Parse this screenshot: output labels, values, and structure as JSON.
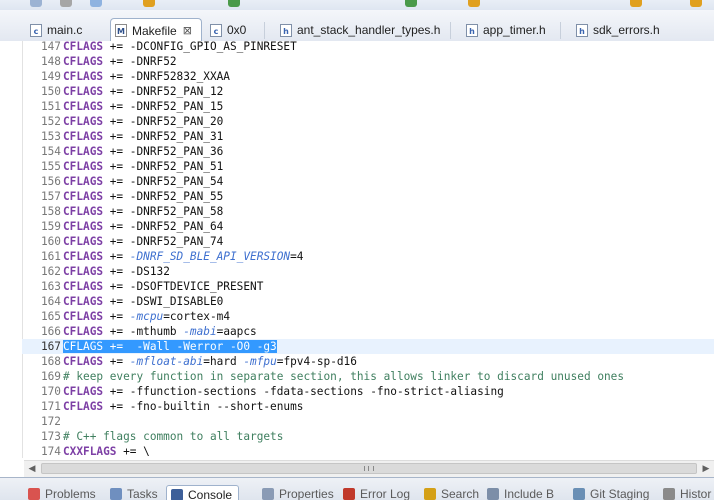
{
  "editor_tabs": [
    {
      "label": "main.c",
      "icon": "c-source-file-icon",
      "active": false
    },
    {
      "label": "Makefile",
      "icon": "makefile-icon",
      "active": true
    },
    {
      "label": "0x0",
      "icon": "c-source-file-icon",
      "active": false
    },
    {
      "label": "ant_stack_handler_types.h",
      "icon": "header-file-icon",
      "active": false
    },
    {
      "label": "app_timer.h",
      "icon": "header-file-icon",
      "active": false
    },
    {
      "label": "sdk_errors.h",
      "icon": "header-file-icon",
      "active": false
    }
  ],
  "close_glyph": "⊠",
  "code_lines": [
    {
      "num": "147",
      "segments": [
        [
          "var",
          "CFLAGS"
        ],
        [
          "code",
          " += -DCONFIG_GPIO_AS_PINRESET"
        ]
      ]
    },
    {
      "num": "148",
      "segments": [
        [
          "var",
          "CFLAGS"
        ],
        [
          "code",
          " += -DNRF52"
        ]
      ]
    },
    {
      "num": "149",
      "segments": [
        [
          "var",
          "CFLAGS"
        ],
        [
          "code",
          " += -DNRF52832_XXAA"
        ]
      ]
    },
    {
      "num": "150",
      "segments": [
        [
          "var",
          "CFLAGS"
        ],
        [
          "code",
          " += -DNRF52_PAN_12"
        ]
      ]
    },
    {
      "num": "151",
      "segments": [
        [
          "var",
          "CFLAGS"
        ],
        [
          "code",
          " += -DNRF52_PAN_15"
        ]
      ]
    },
    {
      "num": "152",
      "segments": [
        [
          "var",
          "CFLAGS"
        ],
        [
          "code",
          " += -DNRF52_PAN_20"
        ]
      ]
    },
    {
      "num": "153",
      "segments": [
        [
          "var",
          "CFLAGS"
        ],
        [
          "code",
          " += -DNRF52_PAN_31"
        ]
      ]
    },
    {
      "num": "154",
      "segments": [
        [
          "var",
          "CFLAGS"
        ],
        [
          "code",
          " += -DNRF52_PAN_36"
        ]
      ]
    },
    {
      "num": "155",
      "segments": [
        [
          "var",
          "CFLAGS"
        ],
        [
          "code",
          " += -DNRF52_PAN_51"
        ]
      ]
    },
    {
      "num": "156",
      "segments": [
        [
          "var",
          "CFLAGS"
        ],
        [
          "code",
          " += -DNRF52_PAN_54"
        ]
      ]
    },
    {
      "num": "157",
      "segments": [
        [
          "var",
          "CFLAGS"
        ],
        [
          "code",
          " += -DNRF52_PAN_55"
        ]
      ]
    },
    {
      "num": "158",
      "segments": [
        [
          "var",
          "CFLAGS"
        ],
        [
          "code",
          " += -DNRF52_PAN_58"
        ]
      ]
    },
    {
      "num": "159",
      "segments": [
        [
          "var",
          "CFLAGS"
        ],
        [
          "code",
          " += -DNRF52_PAN_64"
        ]
      ]
    },
    {
      "num": "160",
      "segments": [
        [
          "var",
          "CFLAGS"
        ],
        [
          "code",
          " += -DNRF52_PAN_74"
        ]
      ]
    },
    {
      "num": "161",
      "segments": [
        [
          "var",
          "CFLAGS"
        ],
        [
          "code",
          " += "
        ],
        [
          "fn",
          "-DNRF_SD_BLE_API_VERSION"
        ],
        [
          "code",
          "=4"
        ]
      ]
    },
    {
      "num": "162",
      "segments": [
        [
          "var",
          "CFLAGS"
        ],
        [
          "code",
          " += -DS132"
        ]
      ]
    },
    {
      "num": "163",
      "segments": [
        [
          "var",
          "CFLAGS"
        ],
        [
          "code",
          " += -DSOFTDEVICE_PRESENT"
        ]
      ]
    },
    {
      "num": "164",
      "segments": [
        [
          "var",
          "CFLAGS"
        ],
        [
          "code",
          " += -DSWI_DISABLE0"
        ]
      ]
    },
    {
      "num": "165",
      "segments": [
        [
          "var",
          "CFLAGS"
        ],
        [
          "code",
          " += "
        ],
        [
          "fn",
          "-mcpu"
        ],
        [
          "code",
          "=cortex-m4"
        ]
      ]
    },
    {
      "num": "166",
      "segments": [
        [
          "var",
          "CFLAGS"
        ],
        [
          "code",
          " += -mthumb "
        ],
        [
          "fn",
          "-mabi"
        ],
        [
          "code",
          "=aapcs"
        ]
      ]
    },
    {
      "num": "167",
      "current": true,
      "segments": [
        [
          "sel",
          "CFLAGS +=  -Wall -Werror -O0 -g3"
        ]
      ]
    },
    {
      "num": "168",
      "segments": [
        [
          "var",
          "CFLAGS"
        ],
        [
          "code",
          " += "
        ],
        [
          "fn",
          "-mfloat-abi"
        ],
        [
          "code",
          "=hard "
        ],
        [
          "fn",
          "-mfpu"
        ],
        [
          "code",
          "=fpv4-sp-d16"
        ]
      ]
    },
    {
      "num": "169",
      "segments": [
        [
          "cmt",
          "# keep every function in separate section, this allows linker to discard unused ones"
        ]
      ]
    },
    {
      "num": "170",
      "segments": [
        [
          "var",
          "CFLAGS"
        ],
        [
          "code",
          " += -ffunction-sections -fdata-sections -fno-strict-aliasing"
        ]
      ]
    },
    {
      "num": "171",
      "segments": [
        [
          "var",
          "CFLAGS"
        ],
        [
          "code",
          " += -fno-builtin --short-enums"
        ]
      ]
    },
    {
      "num": "172",
      "segments": []
    },
    {
      "num": "173",
      "segments": [
        [
          "cmt",
          "# C++ flags common to all targets"
        ]
      ]
    },
    {
      "num": "174",
      "segments": [
        [
          "var",
          "CXXFLAGS"
        ],
        [
          "code",
          " += \\"
        ]
      ]
    }
  ],
  "bottom_tabs": [
    {
      "label": "Problems",
      "icon": "problems-icon",
      "color": "#d9534f"
    },
    {
      "label": "Tasks",
      "icon": "tasks-icon",
      "color": "#6f8fbf"
    },
    {
      "label": "Console",
      "icon": "console-icon",
      "color": "#3d5f99",
      "active": true
    },
    {
      "label": "Properties",
      "icon": "properties-icon",
      "color": "#8a9bb5"
    },
    {
      "label": "Error Log",
      "icon": "error-log-icon",
      "color": "#c0392b"
    },
    {
      "label": "Search",
      "icon": "search-icon",
      "color": "#d4a017"
    },
    {
      "label": "Include B",
      "icon": "include-browser-icon",
      "color": "#7c8ea8"
    },
    {
      "label": "Git Staging",
      "icon": "git-staging-icon",
      "color": "#6a8fb5"
    },
    {
      "label": "Histor",
      "icon": "history-icon",
      "color": "#8a8a8a"
    }
  ],
  "colors": {
    "selection": "#3399ff",
    "current_line": "#e8f2fe",
    "keyword_var": "#7d3fa5",
    "function": "#3d6fcf",
    "comment": "#3f7f5f"
  }
}
